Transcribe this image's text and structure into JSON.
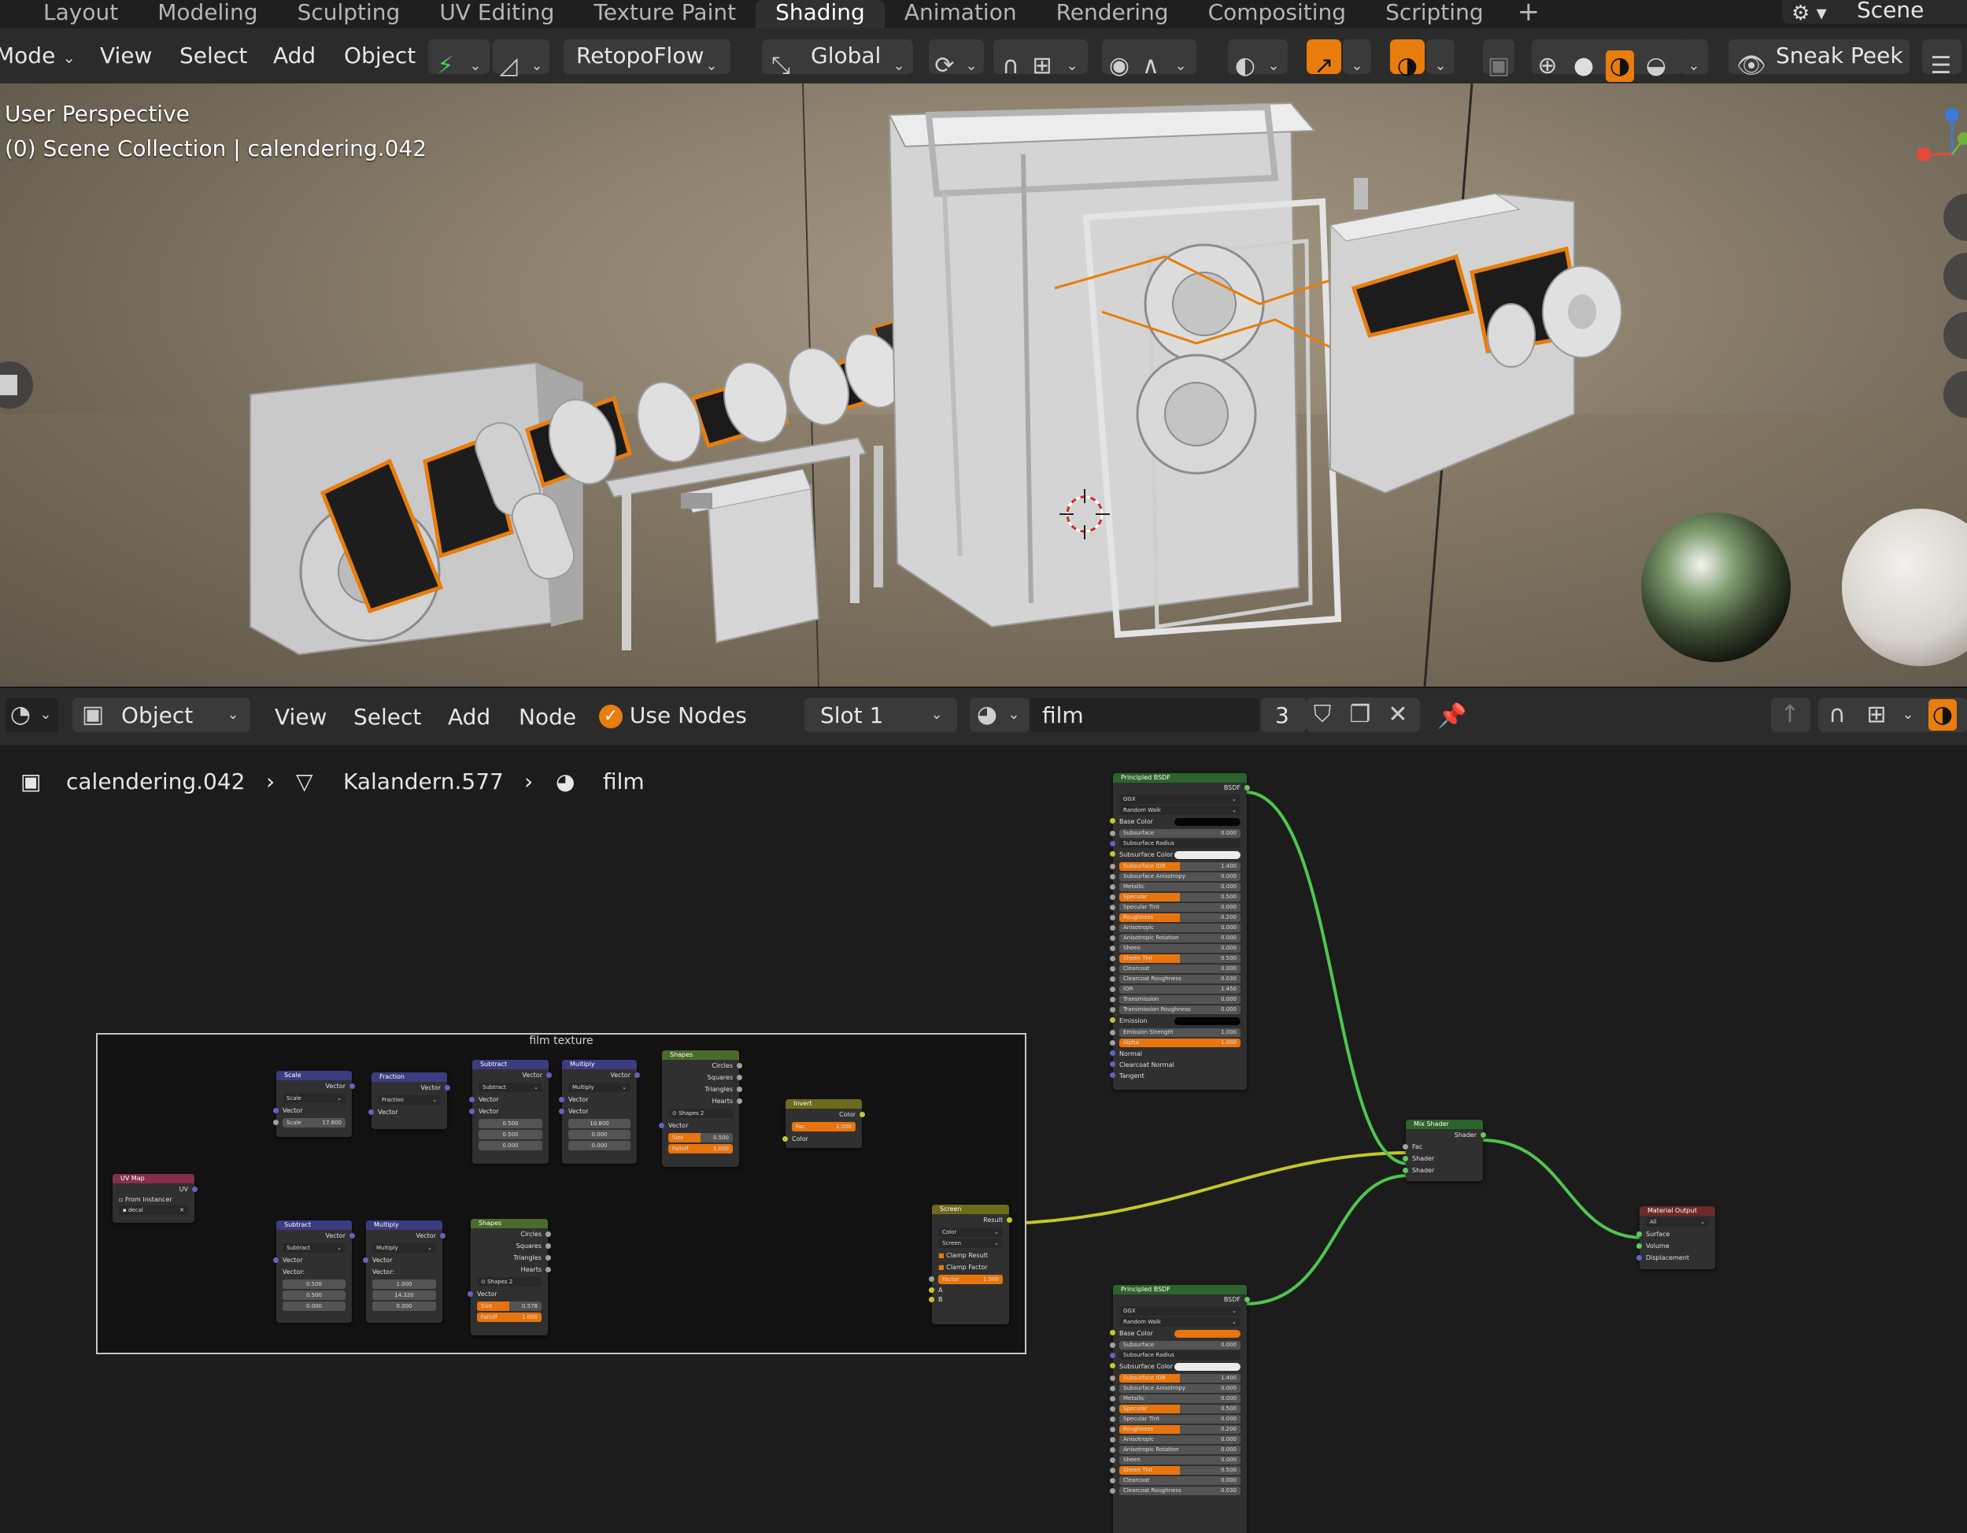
{
  "workspace_tabs": [
    "Layout",
    "Modeling",
    "Sculpting",
    "UV Editing",
    "Texture Paint",
    "Shading",
    "Animation",
    "Rendering",
    "Compositing",
    "Scripting"
  ],
  "active_tab": "Shading",
  "add_tab": "+",
  "scene": {
    "label": "Scene"
  },
  "viewport_header": {
    "mode": "Mode",
    "menus": [
      "View",
      "Select",
      "Add",
      "Object"
    ],
    "addon": "RetopoFlow",
    "orientation": "Global",
    "sneak_peek": "Sneak Peek"
  },
  "viewport": {
    "perspective": "User Perspective",
    "collection": "(0) Scene Collection | calendering.042"
  },
  "node_header": {
    "object_mode": "Object",
    "menus": [
      "View",
      "Select",
      "Add",
      "Node"
    ],
    "use_nodes": "Use Nodes",
    "slot": "Slot 1",
    "material": "film",
    "users": "3"
  },
  "breadcrumb": {
    "object": "calendering.042",
    "mesh": "Kalandern.577",
    "material": "film"
  },
  "frame": {
    "label": "film texture"
  },
  "nodes": {
    "uvmap": {
      "title": "UV Map",
      "out": "UV",
      "from_instancer": "From Instancer",
      "map": "decal"
    },
    "scale": {
      "title": "Scale",
      "out": "Vector",
      "op": "Scale",
      "in": "Vector",
      "scale_label": "Scale",
      "scale_val": "17.600"
    },
    "fraction": {
      "title": "Fraction",
      "out": "Vector",
      "op": "Fraction",
      "in": "Vector"
    },
    "subtract1": {
      "title": "Subtract",
      "out": "Vector",
      "op": "Subtract",
      "in1": "Vector",
      "in2": "Vector",
      "v": [
        "0.500",
        "0.500",
        "0.000"
      ]
    },
    "multiply1": {
      "title": "Multiply",
      "out": "Vector",
      "op": "Multiply",
      "in1": "Vector",
      "in2": "Vector",
      "v": [
        "10.800",
        "0.000",
        "0.000"
      ]
    },
    "shapes1": {
      "title": "Shapes",
      "outs": [
        "Circles",
        "Squares",
        "Triangles",
        "Hearts"
      ],
      "group": "Shapes",
      "users": "2",
      "in": "Vector",
      "size_label": "Size",
      "size_val": "0.500",
      "falloff_label": "Falloff",
      "falloff_val": "1.000"
    },
    "invert": {
      "title": "Invert",
      "out": "Color",
      "fac_label": "Fac",
      "fac_val": "1.000",
      "in": "Color"
    },
    "subtract2": {
      "title": "Subtract",
      "out": "Vector",
      "op": "Subtract",
      "in1": "Vector",
      "in2": "Vector:",
      "v": [
        "0.500",
        "0.500",
        "0.000"
      ]
    },
    "multiply2": {
      "title": "Multiply",
      "out": "Vector",
      "op": "Multiply",
      "in1": "Vector",
      "in2": "Vector:",
      "v": [
        "1.000",
        "14.320",
        "0.000"
      ]
    },
    "shapes2": {
      "title": "Shapes",
      "outs": [
        "Circles",
        "Squares",
        "Triangles",
        "Hearts"
      ],
      "group": "Shapes",
      "users": "2",
      "in": "Vector",
      "size_label": "Size",
      "size_val": "0.578",
      "falloff_label": "Falloff",
      "falloff_val": "1.000"
    },
    "screen": {
      "title": "Screen",
      "out": "Result",
      "type": "Color",
      "blend": "Screen",
      "clamp_result": "Clamp Result",
      "clamp_factor": "Clamp Factor",
      "factor_label": "Factor",
      "factor_val": "1.000",
      "a": "A",
      "b": "B"
    },
    "bsdf1": {
      "title": "Principled BSDF",
      "out": "BSDF",
      "dist": "GGX",
      "sss": "Random Walk",
      "rows": [
        [
          "Base Color",
          "",
          "black"
        ],
        [
          "Subsurface",
          "0.000",
          "field"
        ],
        [
          "Subsurface Radius",
          "",
          "dd"
        ],
        [
          "Subsurface Color",
          "",
          "white"
        ],
        [
          "Subsurface IOR",
          "1.400",
          "orange"
        ],
        [
          "Subsurface Anisotropy",
          "0.000",
          "field"
        ],
        [
          "Metallic",
          "0.000",
          "field"
        ],
        [
          "Specular",
          "0.500",
          "orange"
        ],
        [
          "Specular Tint",
          "0.000",
          "field"
        ],
        [
          "Roughness",
          "0.200",
          "orange"
        ],
        [
          "Anisotropic",
          "0.000",
          "field"
        ],
        [
          "Anisotropic Rotation",
          "0.000",
          "field"
        ],
        [
          "Sheen",
          "0.000",
          "field"
        ],
        [
          "Sheen Tint",
          "0.500",
          "orange"
        ],
        [
          "Clearcoat",
          "0.000",
          "field"
        ],
        [
          "Clearcoat Roughness",
          "0.030",
          "field"
        ],
        [
          "IOR",
          "1.450",
          "field"
        ],
        [
          "Transmission",
          "0.000",
          "field"
        ],
        [
          "Transmission Roughness",
          "0.000",
          "field"
        ],
        [
          "Emission",
          "",
          "black"
        ],
        [
          "Emission Strength",
          "1.000",
          "field"
        ],
        [
          "Alpha",
          "1.000",
          "full"
        ],
        [
          "Normal",
          "",
          "label"
        ],
        [
          "Clearcoat Normal",
          "",
          "label"
        ],
        [
          "Tangent",
          "",
          "label"
        ]
      ]
    },
    "bsdf2": {
      "title": "Principled BSDF",
      "out": "BSDF",
      "dist": "GGX",
      "sss": "Random Walk",
      "rows": [
        [
          "Base Color",
          "",
          "orange-col"
        ],
        [
          "Subsurface",
          "0.000",
          "field"
        ],
        [
          "Subsurface Radius",
          "",
          "dd"
        ],
        [
          "Subsurface Color",
          "",
          "white"
        ],
        [
          "Subsurface IOR",
          "1.400",
          "orange"
        ],
        [
          "Subsurface Anisotropy",
          "0.000",
          "field"
        ],
        [
          "Metallic",
          "0.000",
          "field"
        ],
        [
          "Specular",
          "0.500",
          "orange"
        ],
        [
          "Specular Tint",
          "0.000",
          "field"
        ],
        [
          "Roughness",
          "0.200",
          "orange"
        ],
        [
          "Anisotropic",
          "0.000",
          "field"
        ],
        [
          "Anisotropic Rotation",
          "0.000",
          "field"
        ],
        [
          "Sheen",
          "0.000",
          "field"
        ],
        [
          "Sheen Tint",
          "0.500",
          "orange"
        ],
        [
          "Clearcoat",
          "0.000",
          "field"
        ],
        [
          "Clearcoat Roughness",
          "0.030",
          "field"
        ]
      ]
    },
    "mix": {
      "title": "Mix Shader",
      "out": "Shader",
      "ins": [
        "Fac",
        "Shader",
        "Shader"
      ]
    },
    "output": {
      "title": "Material Output",
      "target": "All",
      "ins": [
        "Surface",
        "Volume",
        "Displacement"
      ]
    }
  },
  "colors": {
    "accent": "#e87d0d",
    "shader_wire": "#4fc64f",
    "color_wire": "#c7c729",
    "vector_wire": "#6363c7"
  }
}
